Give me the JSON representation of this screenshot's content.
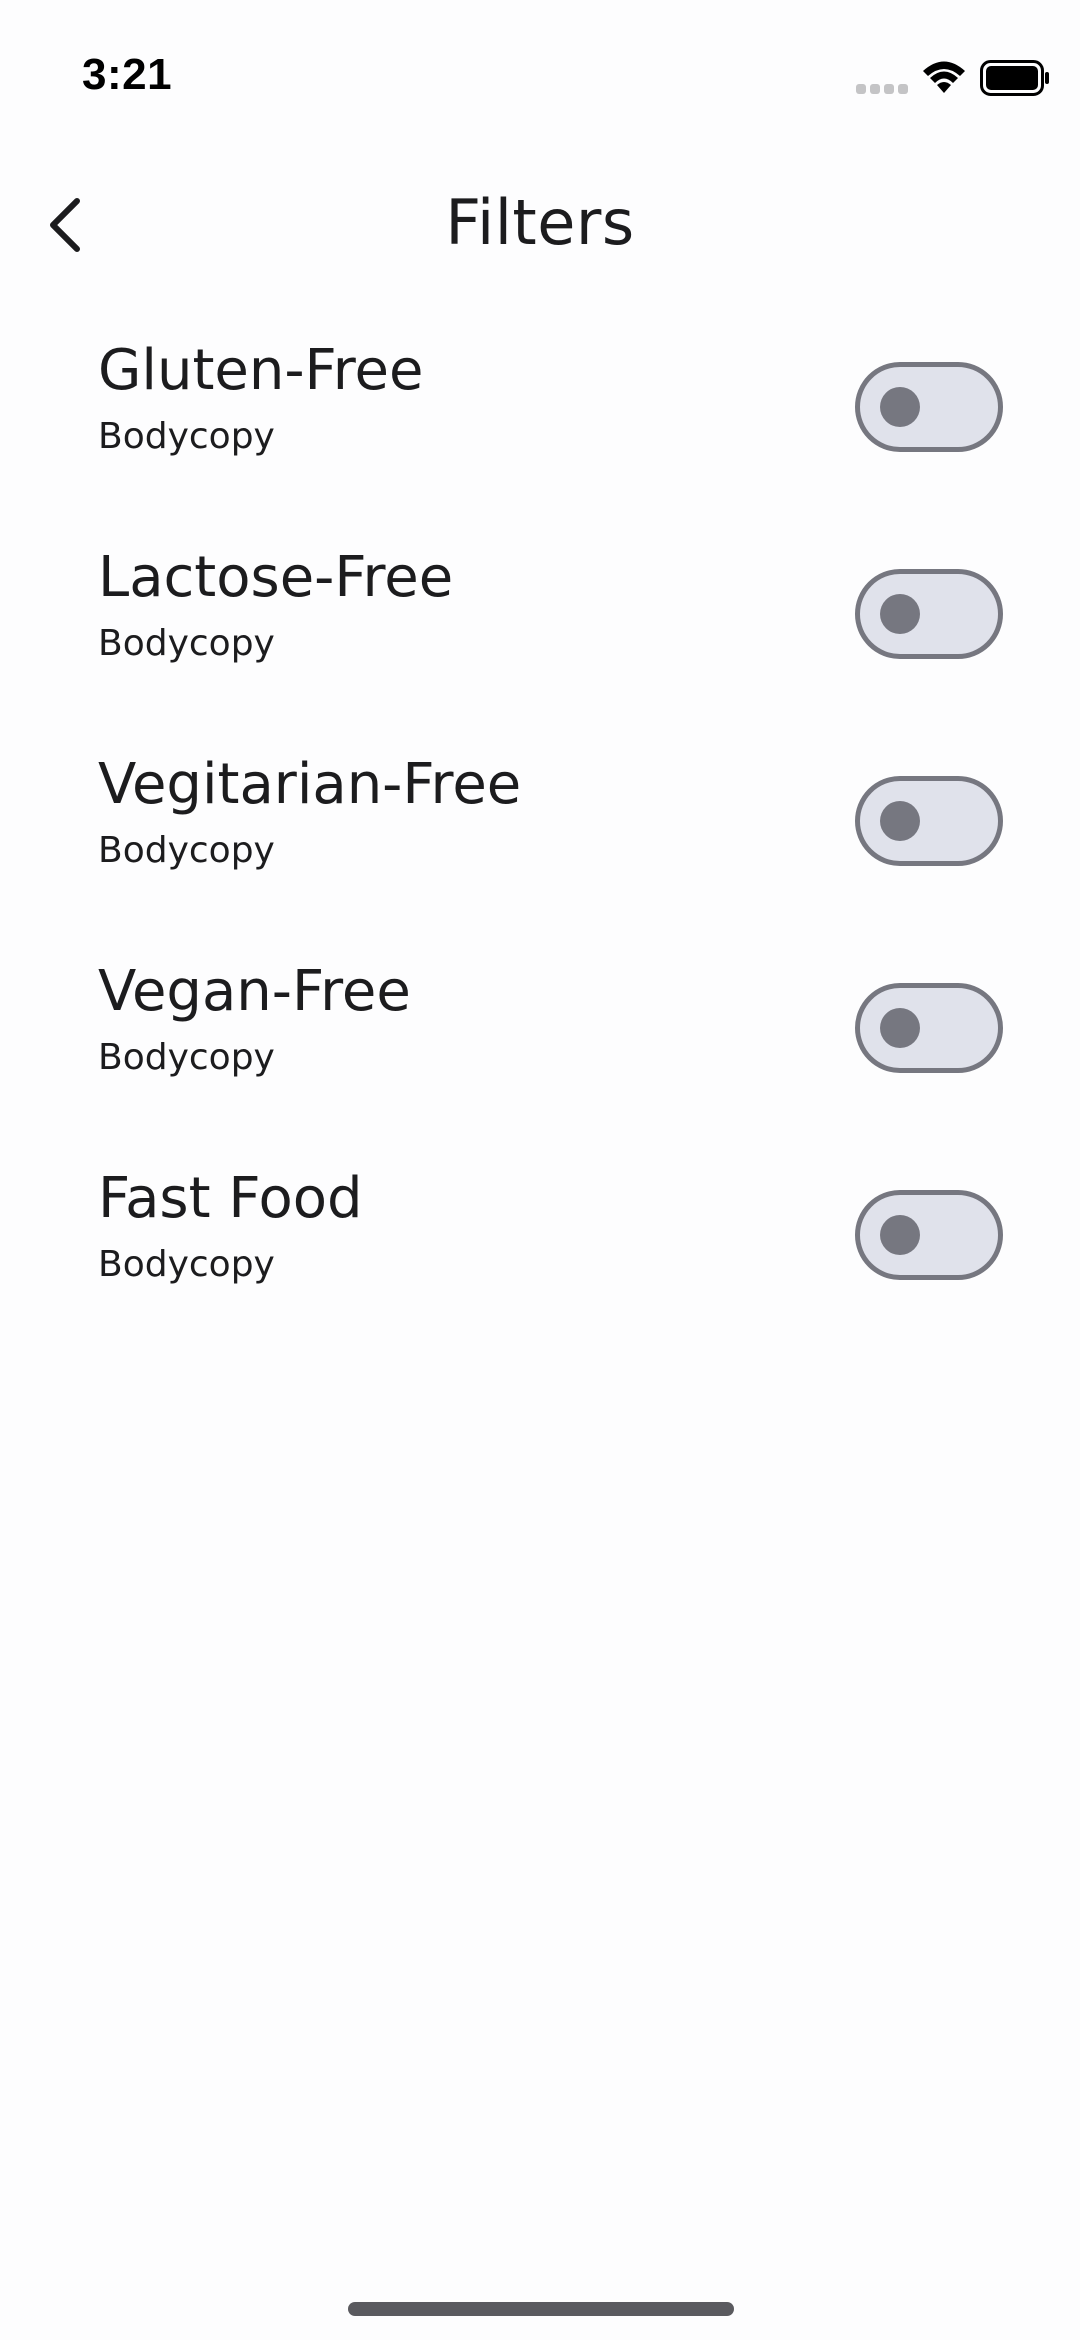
{
  "status_bar": {
    "time": "3:21"
  },
  "header": {
    "title": "Filters",
    "back_icon": "chevron-left-icon"
  },
  "filters": [
    {
      "label": "Gluten-Free",
      "subtitle": "Bodycopy",
      "enabled": false
    },
    {
      "label": "Lactose-Free",
      "subtitle": "Bodycopy",
      "enabled": false
    },
    {
      "label": "Vegitarian-Free",
      "subtitle": "Bodycopy",
      "enabled": false
    },
    {
      "label": "Vegan-Free",
      "subtitle": "Bodycopy",
      "enabled": false
    },
    {
      "label": "Fast Food",
      "subtitle": "Bodycopy",
      "enabled": false
    }
  ],
  "colors": {
    "background": "#FDFDFE",
    "text": "#1C1C1E",
    "toggle_border": "#767780",
    "toggle_track": "#E0E2EB",
    "toggle_knob": "#767780"
  }
}
